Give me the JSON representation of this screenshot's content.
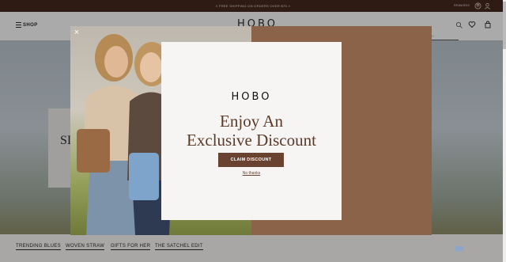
{
  "topbar": {
    "promo": "// FREE SHIPPING ON ORDERS OVER $75 //",
    "rewards": "REWARDS"
  },
  "header": {
    "logo": "HOBO",
    "shop_label": "SHOP",
    "search_placeholder": "SEARCH"
  },
  "hero": {
    "partial_text": "SI"
  },
  "nav": {
    "items": [
      "TRENDING BLUES",
      "WOVEN STRAW",
      "GIFTS FOR HER",
      "THE SATCHEL EDIT"
    ]
  },
  "modal": {
    "close_glyph": "×",
    "logo": "HOBO",
    "headline_line1": "Enjoy An",
    "headline_line2": "Exclusive Discount",
    "cta": "CLAIM DISCOUNT",
    "dismiss": "No thanks"
  },
  "colors": {
    "topbar": "#3b1f15",
    "modal_bg": "#8b6349",
    "cta": "#6a4330",
    "headline": "#5a3a28"
  },
  "icons": [
    "account-icon",
    "user-icon",
    "search-icon",
    "heart-icon",
    "bag-icon",
    "close-icon",
    "chat-icon",
    "menu-icon"
  ]
}
